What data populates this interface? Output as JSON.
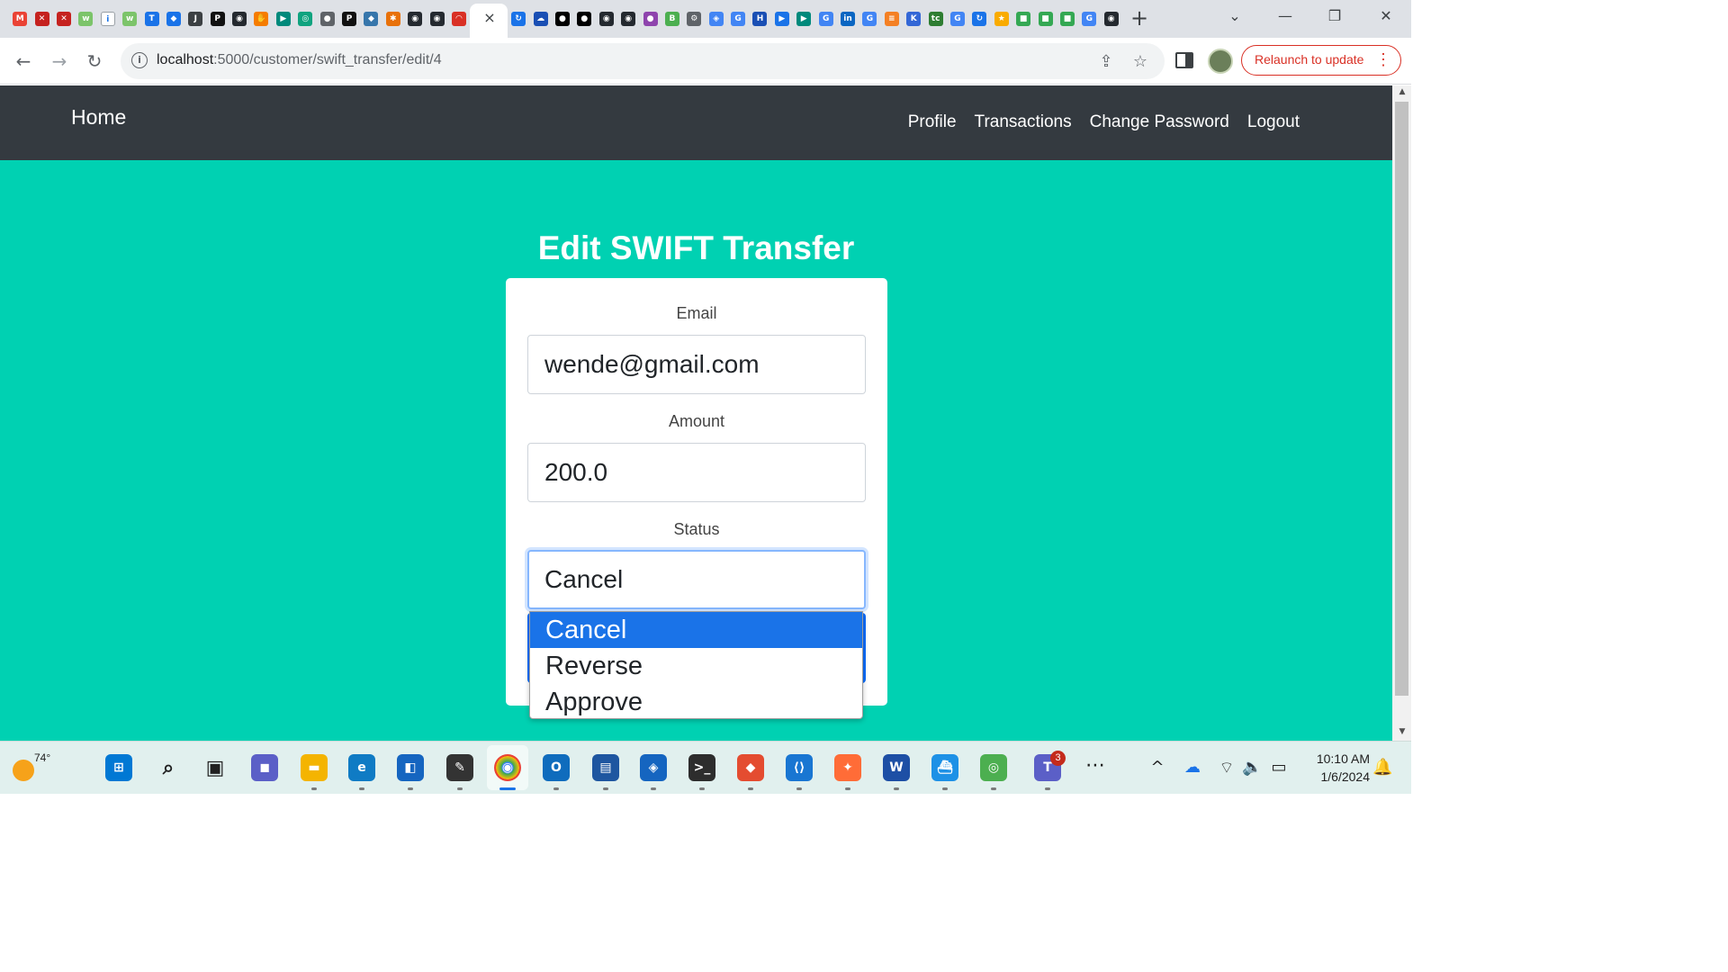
{
  "browser": {
    "tab_close": "×",
    "new_tab": "+",
    "url_host": "localhost",
    "url_path": ":5000/customer/swift_transfer/edit/4",
    "relaunch_label": "Relaunch to update",
    "relaunch_menu": "⋮",
    "back_glyph": "←",
    "forward_glyph": "→",
    "reload_glyph": "↻",
    "info_glyph": "i",
    "share_glyph": "⇪",
    "star_glyph": "☆",
    "tab_search_glyph": "⌄",
    "minimize_glyph": "—",
    "restore_glyph": "❐",
    "close_glyph": "✕",
    "favicons": [
      {
        "name": "gmail",
        "color": "#ea4335",
        "glyph": "M"
      },
      {
        "name": "red-app-1",
        "color": "#c5221f",
        "glyph": "✕"
      },
      {
        "name": "red-app-2",
        "color": "#c5221f",
        "glyph": "✕"
      },
      {
        "name": "lw-1",
        "color": "#7cc46a",
        "glyph": "w"
      },
      {
        "name": "info-app",
        "color": "#ffffff",
        "glyph": "i"
      },
      {
        "name": "lw-2",
        "color": "#7cc46a",
        "glyph": "w"
      },
      {
        "name": "t-app",
        "color": "#1a73e8",
        "glyph": "T"
      },
      {
        "name": "diamond-app",
        "color": "#1a73e8",
        "glyph": "◆"
      },
      {
        "name": "j2c",
        "color": "#3c4043",
        "glyph": "J"
      },
      {
        "name": "p-app-1",
        "color": "#111111",
        "glyph": "P"
      },
      {
        "name": "github-1",
        "color": "#24292f",
        "glyph": "◉"
      },
      {
        "name": "orange-app",
        "color": "#f57c00",
        "glyph": "✋"
      },
      {
        "name": "meet-app",
        "color": "#00897b",
        "glyph": "▶"
      },
      {
        "name": "chatgpt-app",
        "color": "#10a37f",
        "glyph": "◎"
      },
      {
        "name": "gray-app",
        "color": "#5f6368",
        "glyph": "●"
      },
      {
        "name": "p-app-2",
        "color": "#111111",
        "glyph": "P"
      },
      {
        "name": "python-app",
        "color": "#3776ab",
        "glyph": "◆"
      },
      {
        "name": "spark-app",
        "color": "#e8710a",
        "glyph": "✱"
      },
      {
        "name": "github-2",
        "color": "#24292f",
        "glyph": "◉"
      },
      {
        "name": "github-3",
        "color": "#24292f",
        "glyph": "◉"
      },
      {
        "name": "arc-app",
        "color": "#d93025",
        "glyph": "◠"
      }
    ],
    "favicons_right": [
      {
        "name": "sync-app",
        "color": "#1a73e8",
        "glyph": "↻"
      },
      {
        "name": "cloud-app",
        "color": "#1a4fb4",
        "glyph": "☁"
      },
      {
        "name": "medium-1",
        "color": "#000000",
        "glyph": "●"
      },
      {
        "name": "medium-2",
        "color": "#000000",
        "glyph": "●"
      },
      {
        "name": "github-4",
        "color": "#24292f",
        "glyph": "◉"
      },
      {
        "name": "github-5",
        "color": "#24292f",
        "glyph": "◉"
      },
      {
        "name": "purple-app",
        "color": "#8e44ad",
        "glyph": "●"
      },
      {
        "name": "b64-app",
        "color": "#4caf50",
        "glyph": "B"
      },
      {
        "name": "gear-app",
        "color": "#5f6368",
        "glyph": "⚙"
      },
      {
        "name": "shield-app",
        "color": "#4285f4",
        "glyph": "◈"
      },
      {
        "name": "google-1",
        "color": "#4285f4",
        "glyph": "G"
      },
      {
        "name": "hst-app",
        "color": "#1a4fb4",
        "glyph": "H"
      },
      {
        "name": "video-app",
        "color": "#1a73e8",
        "glyph": "▶"
      },
      {
        "name": "meet-app-2",
        "color": "#00897b",
        "glyph": "▶"
      },
      {
        "name": "google-2",
        "color": "#4285f4",
        "glyph": "G"
      },
      {
        "name": "linkedin-app",
        "color": "#0a66c2",
        "glyph": "in"
      },
      {
        "name": "google-3",
        "color": "#4285f4",
        "glyph": "G"
      },
      {
        "name": "stack-app",
        "color": "#f48024",
        "glyph": "≡"
      },
      {
        "name": "k-app",
        "color": "#3367d6",
        "glyph": "K"
      },
      {
        "name": "tc-app",
        "color": "#2e7d32",
        "glyph": "tc"
      },
      {
        "name": "google-4",
        "color": "#4285f4",
        "glyph": "G"
      },
      {
        "name": "sync-app-2",
        "color": "#1a73e8",
        "glyph": "↻"
      },
      {
        "name": "star-app",
        "color": "#f9ab00",
        "glyph": "★"
      },
      {
        "name": "green-app-1",
        "color": "#34a853",
        "glyph": "■"
      },
      {
        "name": "green-app-2",
        "color": "#34a853",
        "glyph": "■"
      },
      {
        "name": "green-app-3",
        "color": "#34a853",
        "glyph": "■"
      },
      {
        "name": "google-5",
        "color": "#4285f4",
        "glyph": "G"
      },
      {
        "name": "github-6",
        "color": "#24292f",
        "glyph": "◉"
      }
    ]
  },
  "navbar": {
    "brand": "Home",
    "links": [
      "Profile",
      "Transactions",
      "Change Password",
      "Logout"
    ]
  },
  "page": {
    "title": "Edit SWIFT Transfer",
    "fields": {
      "email_label": "Email",
      "email_value": "wende@gmail.com",
      "amount_label": "Amount",
      "amount_value": "200.0",
      "status_label": "Status",
      "status_value": "Cancel"
    },
    "status_options": [
      "Cancel",
      "Reverse",
      "Approve"
    ],
    "selected_option": "Cancel"
  },
  "taskbar": {
    "weather_temp": "74°",
    "time": "10:10 AM",
    "date": "1/6/2024",
    "teams_badge": "3",
    "more_glyph": "⋯",
    "chevron_glyph": "^",
    "wifi_glyph": "⌔",
    "volume_glyph": "🔈",
    "battery_glyph": "▭",
    "bell_glyph": "🔔",
    "apps": [
      {
        "name": "windows-start",
        "color": "#0078d4",
        "glyph": "⊞"
      },
      {
        "name": "search",
        "color": "#202020",
        "glyph": "⌕"
      },
      {
        "name": "task-view",
        "color": "#202020",
        "glyph": "▣"
      },
      {
        "name": "teams-chat",
        "color": "#5b5fc7",
        "glyph": "◼"
      },
      {
        "name": "file-explorer",
        "color": "#f4b400",
        "glyph": "▬"
      },
      {
        "name": "edge",
        "color": "#0f7bc4",
        "glyph": "e"
      },
      {
        "name": "store",
        "color": "#1565c0",
        "glyph": "◧"
      },
      {
        "name": "tool-app",
        "color": "#333333",
        "glyph": "✎"
      },
      {
        "name": "chrome",
        "color": "#ffffff",
        "glyph": "◉"
      },
      {
        "name": "outlook",
        "color": "#0f6cbd",
        "glyph": "O"
      },
      {
        "name": "remote-desktop",
        "color": "#1e56a0",
        "glyph": "▤"
      },
      {
        "name": "defender",
        "color": "#1565c0",
        "glyph": "◈"
      },
      {
        "name": "terminal",
        "color": "#2d2d2d",
        "glyph": ">_"
      },
      {
        "name": "git",
        "color": "#e44c30",
        "glyph": "◆"
      },
      {
        "name": "vscode",
        "color": "#1976d2",
        "glyph": "⟨⟩"
      },
      {
        "name": "postman",
        "color": "#ff6c37",
        "glyph": "✦"
      },
      {
        "name": "word",
        "color": "#1d4fa5",
        "glyph": "W"
      },
      {
        "name": "docker",
        "color": "#1d91e6",
        "glyph": "⛴"
      },
      {
        "name": "green-round-app",
        "color": "#4caf50",
        "glyph": "◎"
      },
      {
        "name": "teams",
        "color": "#5b5fc7",
        "glyph": "T"
      }
    ]
  }
}
